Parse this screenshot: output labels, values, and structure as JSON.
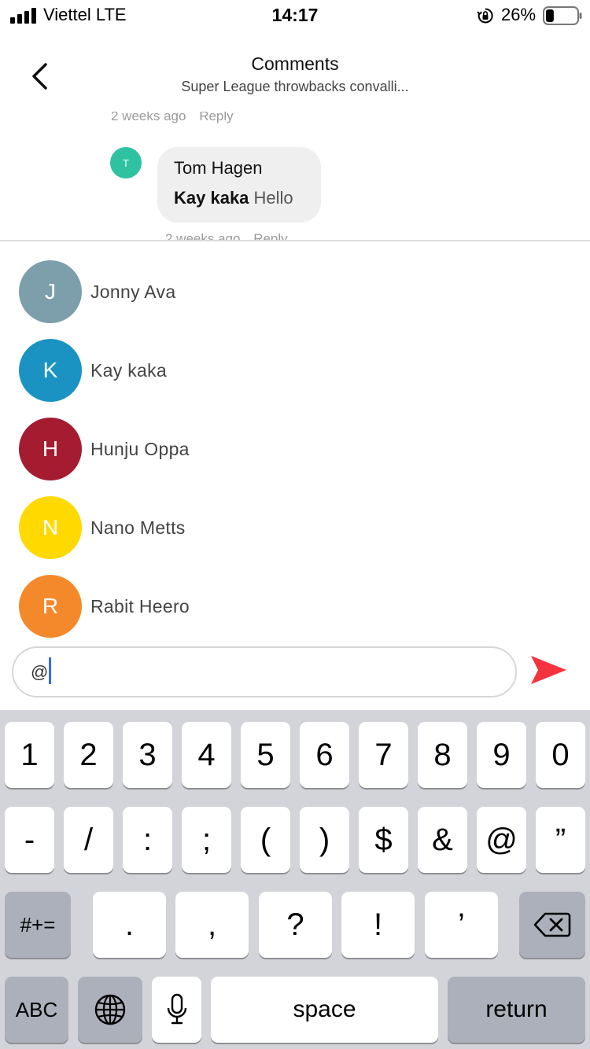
{
  "status_bar": {
    "carrier": "Viettel  LTE",
    "time": "14:17",
    "battery_percent": "26%",
    "battery_level": 0.26,
    "icons": [
      "signal-bars-icon",
      "orientation-lock-icon",
      "battery-icon"
    ]
  },
  "header": {
    "back_icon": "chevron-left-icon",
    "title": "Comments",
    "subtitle": "Super League throwbacks convalli..."
  },
  "comments": {
    "meta_top": {
      "time": "2 weeks ago",
      "reply": "Reply"
    },
    "comment": {
      "avatar_letter": "T",
      "avatar_color": "#2fc2a0",
      "author": "Tom Hagen",
      "mention": "Kay kaka",
      "text": " Hello",
      "time": "2 weeks ago",
      "reply": "Reply"
    }
  },
  "mentions": [
    {
      "letter": "J",
      "name": "Jonny Ava",
      "color": "#7d9fac"
    },
    {
      "letter": "K",
      "name": "Kay kaka",
      "color": "#1a93c2"
    },
    {
      "letter": "H",
      "name": "Hunju Oppa",
      "color": "#a51c30"
    },
    {
      "letter": "N",
      "name": "Nano Metts",
      "color": "#ffd900"
    },
    {
      "letter": "R",
      "name": "Rabit Heero",
      "color": "#f4892b"
    }
  ],
  "input": {
    "value": "@",
    "send_icon": "send-icon",
    "send_color": "#f5333f"
  },
  "keyboard": {
    "row1": [
      "1",
      "2",
      "3",
      "4",
      "5",
      "6",
      "7",
      "8",
      "9",
      "0"
    ],
    "row2": [
      "-",
      "/",
      ":",
      ";",
      "(",
      ")",
      "$",
      "&",
      "@",
      "”"
    ],
    "row3_left": "#+=",
    "row3": [
      ".",
      ",",
      "?",
      "!",
      "’"
    ],
    "row3_right_icon": "backspace-icon",
    "abc": "ABC",
    "globe_icon": "globe-icon",
    "mic_icon": "microphone-icon",
    "space": "space",
    "return": "return"
  }
}
